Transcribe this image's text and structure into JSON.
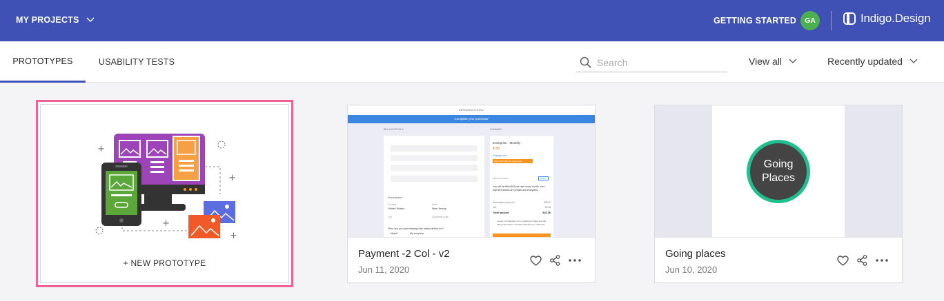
{
  "header": {
    "projects_label": "MY PROJECTS",
    "getting_started": "GETTING STARTED",
    "avatar_initials": "GA",
    "brand": "Indigo.Design",
    "bg_color": "#3f51b5"
  },
  "tabs": [
    {
      "label": "PROTOTYPES",
      "active": true
    },
    {
      "label": "USABILITY TESTS",
      "active": false
    }
  ],
  "search": {
    "placeholder": "Search",
    "value": ""
  },
  "filters": {
    "view": "View all",
    "sort": "Recently updated"
  },
  "new_card": {
    "label": "+ NEW PROTOTYPE",
    "highlight_color": "#f06292"
  },
  "cards": [
    {
      "title": "Payment -2 Col - v2",
      "date": "Jun 11, 2020",
      "preview": {
        "company": "INFRAGISTICS INC",
        "banner": "Complete your purchase",
        "billing_heading": "BILLING DETAILS",
        "summary_heading": "SUMMARY",
        "plan": "Enterprise - Monthly",
        "price": "$ 39",
        "change_plan": "Change plan",
        "savings": "Save 20% with the yearly plan",
        "discount": "Discount code",
        "apply": "APPLY",
        "billing_note": "You will be billed $39 per user every month. Your payment details are private and encrypted.",
        "subtotal_label": "Subscription price (x1)",
        "subtotal": "$39.00",
        "tax_label": "Tax",
        "tax": "$4.56",
        "total_label": "Total amount",
        "total": "$43.56",
        "country_label": "Country",
        "country": "United States",
        "state_label": "State",
        "state": "New Jersey",
        "city_label": "City",
        "zip_label": "Zip/postal code",
        "subscriptions_label": "Subscriptions",
        "question": "Who are you purchasing this subscription for?",
        "option_myself": "Myself",
        "option_company": "My company",
        "agree": "I agree to Infragistics Inc's conditions of sales and the billing information I provided matches my credit card."
      }
    },
    {
      "title": "Going places",
      "date": "Jun 10, 2020",
      "logo_text_1": "Going",
      "logo_text_2": "Places"
    }
  ]
}
